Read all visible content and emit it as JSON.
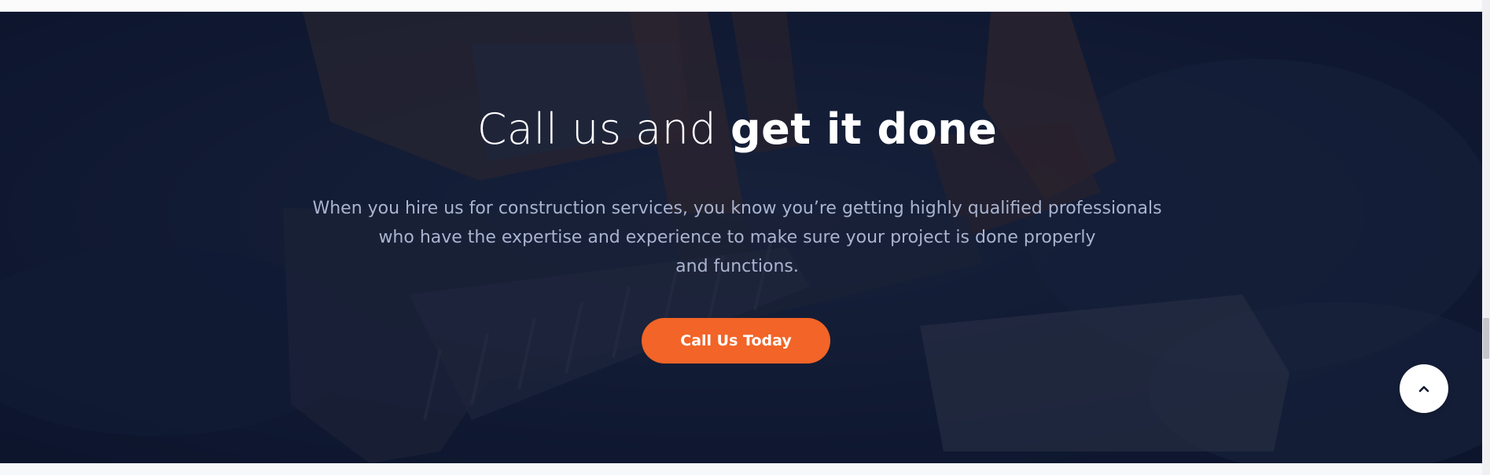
{
  "hero": {
    "title_light": "Call us and",
    "title_bold": "get it done",
    "description_line1": "When you hire us for construction services, you know you’re getting highly qualified professionals",
    "description_line2": "who have the expertise and experience to make sure your project is done properly",
    "description_line3": "and functions.",
    "cta_label": "Call Us Today",
    "background_image": "excavator-construction-site"
  },
  "scroll_top": {
    "icon": "chevron-up-icon"
  },
  "colors": {
    "accent": "#f26427",
    "overlay": "#0e1730",
    "title": "#ffffff",
    "description": "#aab4cf"
  }
}
